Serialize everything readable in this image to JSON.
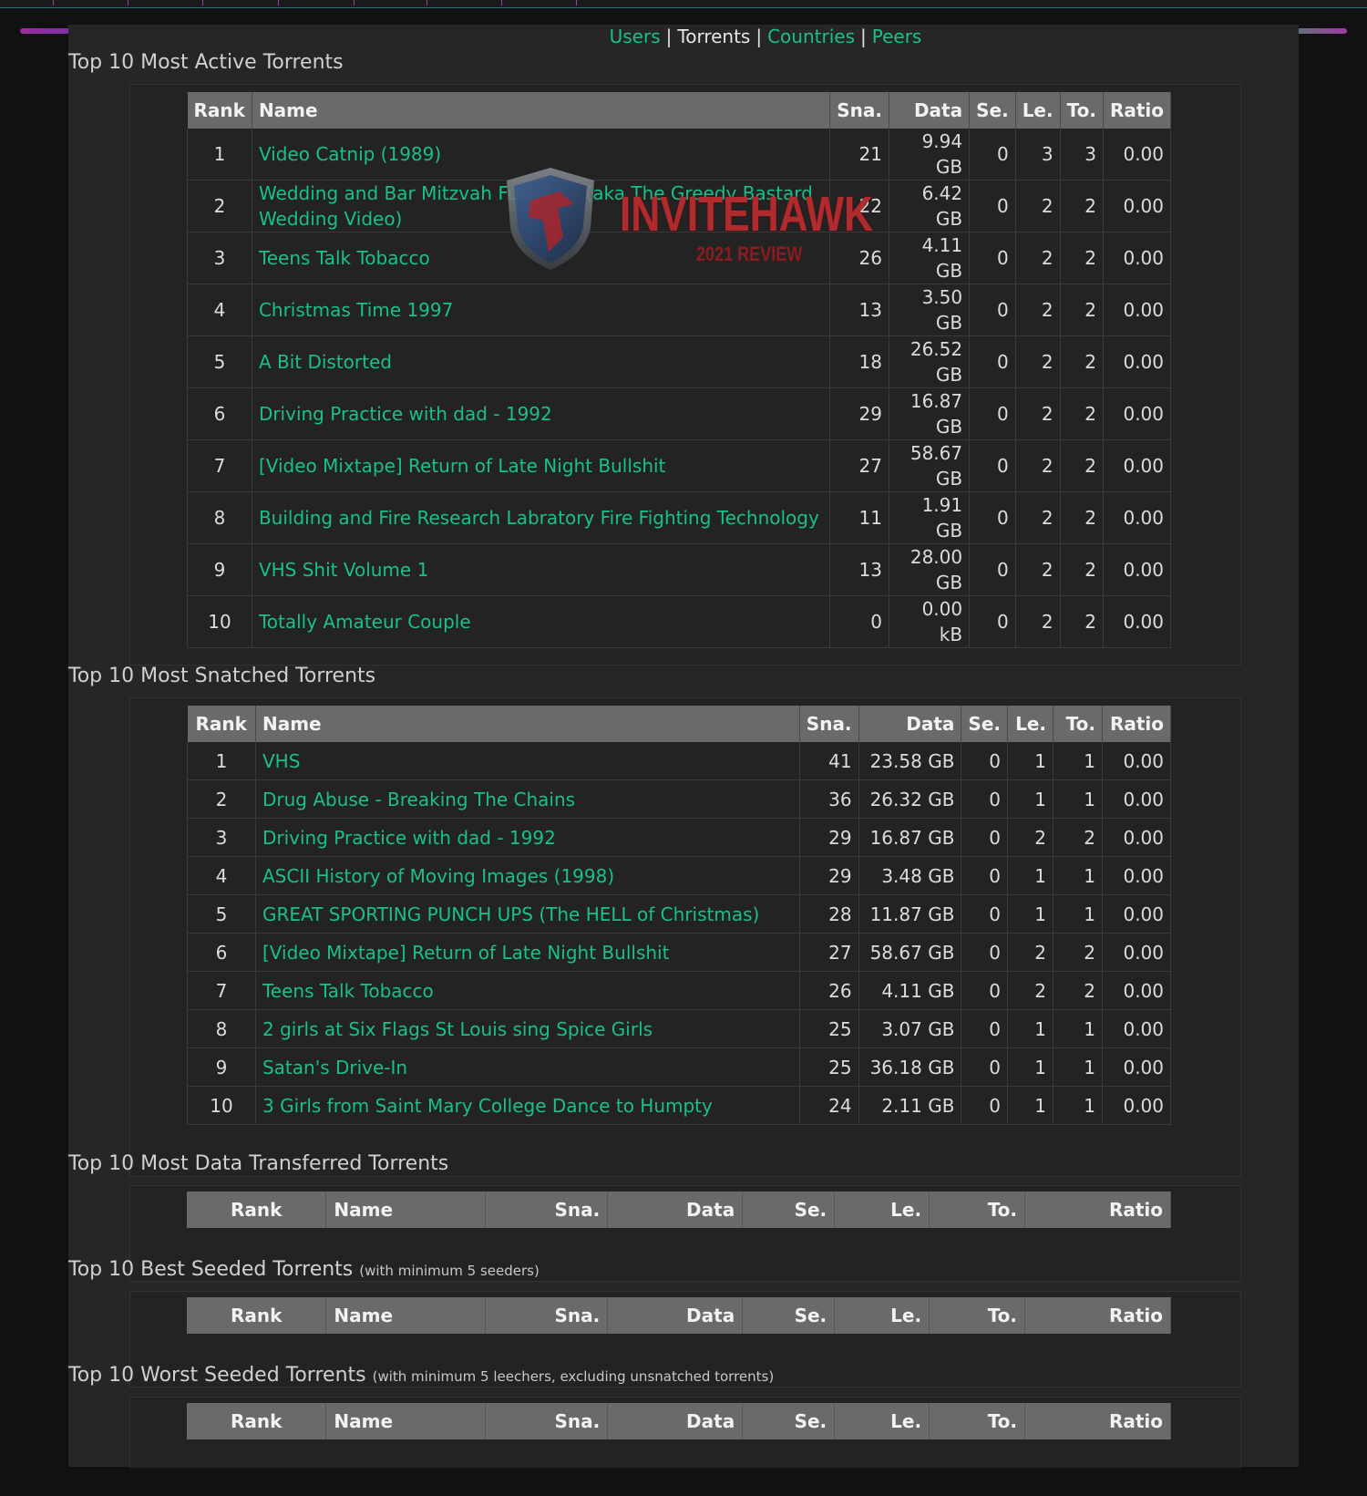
{
  "nav": {
    "users": "Users",
    "torrents": "Torrents",
    "countries": "Countries",
    "peers": "Peers",
    "separator": "|"
  },
  "columns": {
    "rank": "Rank",
    "name": "Name",
    "sna": "Sna.",
    "data": "Data",
    "se": "Se.",
    "le": "Le.",
    "to": "To.",
    "ratio": "Ratio"
  },
  "sections": {
    "active": {
      "title": "Top 10 Most Active Torrents",
      "rows": [
        {
          "rank": "1",
          "name": "Video Catnip (1989)",
          "sna": "21",
          "data": "9.94 GB",
          "se": "0",
          "le": "3",
          "to": "3",
          "ratio": "0.00"
        },
        {
          "rank": "2",
          "name": "Wedding and Bar Mitzvah Fuck Ups (aka The Greedy Bastard Wedding Video)",
          "sna": "22",
          "data": "6.42 GB",
          "se": "0",
          "le": "2",
          "to": "2",
          "ratio": "0.00"
        },
        {
          "rank": "3",
          "name": "Teens Talk Tobacco",
          "sna": "26",
          "data": "4.11 GB",
          "se": "0",
          "le": "2",
          "to": "2",
          "ratio": "0.00"
        },
        {
          "rank": "4",
          "name": "Christmas Time 1997",
          "sna": "13",
          "data": "3.50 GB",
          "se": "0",
          "le": "2",
          "to": "2",
          "ratio": "0.00"
        },
        {
          "rank": "5",
          "name": "A Bit Distorted",
          "sna": "18",
          "data": "26.52 GB",
          "se": "0",
          "le": "2",
          "to": "2",
          "ratio": "0.00"
        },
        {
          "rank": "6",
          "name": "Driving Practice with dad - 1992",
          "sna": "29",
          "data": "16.87 GB",
          "se": "0",
          "le": "2",
          "to": "2",
          "ratio": "0.00"
        },
        {
          "rank": "7",
          "name": "[Video Mixtape] Return of Late Night Bullshit",
          "sna": "27",
          "data": "58.67 GB",
          "se": "0",
          "le": "2",
          "to": "2",
          "ratio": "0.00"
        },
        {
          "rank": "8",
          "name": "Building and Fire Research Labratory Fire Fighting Technology",
          "sna": "11",
          "data": "1.91 GB",
          "se": "0",
          "le": "2",
          "to": "2",
          "ratio": "0.00"
        },
        {
          "rank": "9",
          "name": "VHS Shit Volume 1",
          "sna": "13",
          "data": "28.00 GB",
          "se": "0",
          "le": "2",
          "to": "2",
          "ratio": "0.00"
        },
        {
          "rank": "10",
          "name": "Totally Amateur Couple",
          "sna": "0",
          "data": "0.00 kB",
          "se": "0",
          "le": "2",
          "to": "2",
          "ratio": "0.00"
        }
      ]
    },
    "snatched": {
      "title": "Top 10 Most Snatched Torrents",
      "rows": [
        {
          "rank": "1",
          "name": "VHS",
          "sna": "41",
          "data": "23.58 GB",
          "se": "0",
          "le": "1",
          "to": "1",
          "ratio": "0.00"
        },
        {
          "rank": "2",
          "name": "Drug Abuse - Breaking The Chains",
          "sna": "36",
          "data": "26.32 GB",
          "se": "0",
          "le": "1",
          "to": "1",
          "ratio": "0.00"
        },
        {
          "rank": "3",
          "name": "Driving Practice with dad - 1992",
          "sna": "29",
          "data": "16.87 GB",
          "se": "0",
          "le": "2",
          "to": "2",
          "ratio": "0.00"
        },
        {
          "rank": "4",
          "name": "ASCII History of Moving Images (1998)",
          "sna": "29",
          "data": "3.48 GB",
          "se": "0",
          "le": "1",
          "to": "1",
          "ratio": "0.00"
        },
        {
          "rank": "5",
          "name": "GREAT SPORTING PUNCH UPS (The HELL of Christmas)",
          "sna": "28",
          "data": "11.87 GB",
          "se": "0",
          "le": "1",
          "to": "1",
          "ratio": "0.00"
        },
        {
          "rank": "6",
          "name": "[Video Mixtape] Return of Late Night Bullshit",
          "sna": "27",
          "data": "58.67 GB",
          "se": "0",
          "le": "2",
          "to": "2",
          "ratio": "0.00"
        },
        {
          "rank": "7",
          "name": "Teens Talk Tobacco",
          "sna": "26",
          "data": "4.11 GB",
          "se": "0",
          "le": "2",
          "to": "2",
          "ratio": "0.00"
        },
        {
          "rank": "8",
          "name": "2 girls at Six Flags St Louis sing Spice Girls",
          "sna": "25",
          "data": "3.07 GB",
          "se": "0",
          "le": "1",
          "to": "1",
          "ratio": "0.00"
        },
        {
          "rank": "9",
          "name": "Satan's Drive-In",
          "sna": "25",
          "data": "36.18 GB",
          "se": "0",
          "le": "1",
          "to": "1",
          "ratio": "0.00"
        },
        {
          "rank": "10",
          "name": "3 Girls from Saint Mary College Dance to Humpty",
          "sna": "24",
          "data": "2.11 GB",
          "se": "0",
          "le": "1",
          "to": "1",
          "ratio": "0.00"
        }
      ]
    },
    "transferred": {
      "title": "Top 10 Most Data Transferred Torrents"
    },
    "best_seeded": {
      "title": "Top 10 Best Seeded Torrents",
      "note": "(with minimum 5 seeders)"
    },
    "worst_seeded": {
      "title": "Top 10 Worst Seeded Torrents",
      "note": "(with minimum 5 leechers, excluding unsnatched torrents)"
    }
  },
  "watermark": {
    "brand": "INVITEHAWK",
    "sub": "2021 REVIEW"
  },
  "colors": {
    "link": "#19c08a",
    "header_bg": "#6a6a6a",
    "panel_bg": "#262626",
    "page_bg": "#111111"
  }
}
